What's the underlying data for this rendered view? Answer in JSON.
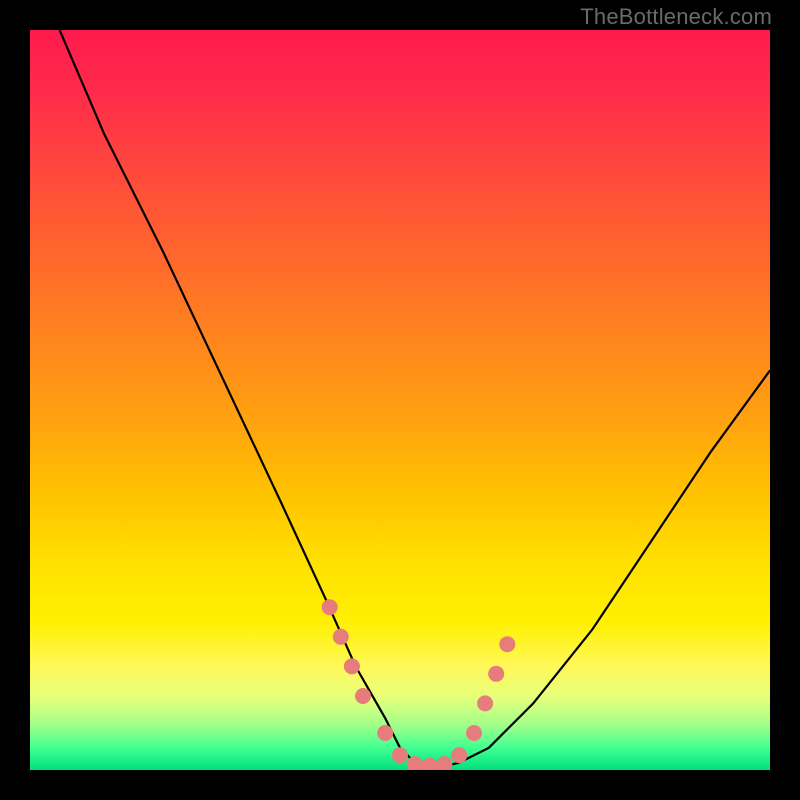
{
  "watermark": "TheBottleneck.com",
  "chart_data": {
    "type": "line",
    "title": "",
    "xlabel": "",
    "ylabel": "",
    "xlim": [
      0,
      100
    ],
    "ylim": [
      0,
      100
    ],
    "series": [
      {
        "name": "curve",
        "x": [
          4,
          10,
          18,
          26,
          34,
          40,
          44,
          48,
          50,
          52,
          54,
          56,
          58,
          62,
          68,
          76,
          84,
          92,
          100
        ],
        "y": [
          100,
          86,
          70,
          53,
          36,
          23,
          14,
          7,
          3,
          1,
          0.5,
          0.5,
          1,
          3,
          9,
          19,
          31,
          43,
          54
        ]
      }
    ],
    "markers": {
      "name": "dots",
      "x": [
        40.5,
        42,
        43.5,
        45,
        48,
        50,
        52,
        54,
        56,
        58,
        60,
        61.5,
        63,
        64.5
      ],
      "y": [
        22,
        18,
        14,
        10,
        5,
        2,
        0.8,
        0.6,
        0.8,
        2,
        5,
        9,
        13,
        17
      ],
      "color": "#e77c7c",
      "radius": 8
    },
    "background_gradient": {
      "top": "#ff1a4d",
      "mid": "#ffd400",
      "bottom": "#00e080"
    }
  }
}
